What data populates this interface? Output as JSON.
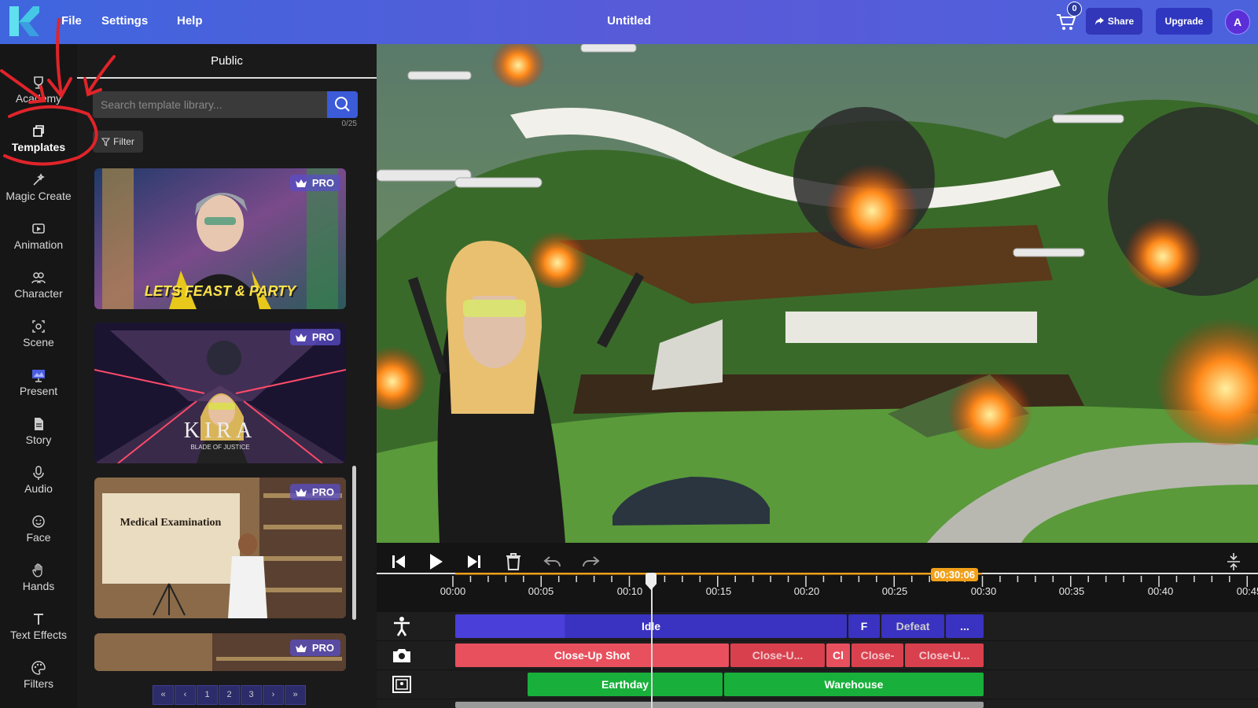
{
  "header": {
    "menu": [
      "File",
      "Settings",
      "Help"
    ],
    "title": "Untitled",
    "cart_count": "0",
    "share_label": "Share",
    "upgrade_label": "Upgrade",
    "avatar_initial": "A"
  },
  "sidebar": {
    "items": [
      {
        "label": "Academy",
        "icon": "trophy-icon"
      },
      {
        "label": "Templates",
        "icon": "templates-icon",
        "active": true
      },
      {
        "label": "Magic Create",
        "icon": "magic-wand-icon"
      },
      {
        "label": "Animation",
        "icon": "play-box-icon"
      },
      {
        "label": "Character",
        "icon": "people-icon"
      },
      {
        "label": "Scene",
        "icon": "scene-icon"
      },
      {
        "label": "Present",
        "icon": "present-icon"
      },
      {
        "label": "Story",
        "icon": "document-icon"
      },
      {
        "label": "Audio",
        "icon": "microphone-icon"
      },
      {
        "label": "Face",
        "icon": "face-icon"
      },
      {
        "label": "Hands",
        "icon": "hand-icon"
      },
      {
        "label": "Text Effects",
        "icon": "text-icon"
      },
      {
        "label": "Filters",
        "icon": "palette-icon"
      }
    ]
  },
  "panel": {
    "tab": "Public",
    "search_placeholder": "Search template library...",
    "counter": "0/25",
    "filter_label": "Filter",
    "cards": [
      {
        "badge": "PRO",
        "caption": "LETS FEAST & PARTY"
      },
      {
        "badge": "PRO",
        "caption": "KIRA",
        "subcaption": "BLADE OF JUSTICE"
      },
      {
        "badge": "PRO",
        "caption": "Medical Examination"
      },
      {
        "badge": "PRO"
      }
    ],
    "pages": [
      "«",
      "‹",
      "1",
      "2",
      "3",
      "›",
      "»"
    ]
  },
  "timeline": {
    "current_time": "00:30:06",
    "ticks": [
      "00:00",
      "00:05",
      "00:10",
      "00:15",
      "00:20",
      "00:25",
      "00:30",
      "00:35",
      "00:40",
      "00:45"
    ],
    "tracks": {
      "animation": [
        {
          "label": "Idle",
          "color": "#4a3fd8"
        },
        {
          "label": "F",
          "color": "#4a3fd8"
        },
        {
          "label": "Defeat",
          "color": "#4a3fd8"
        },
        {
          "label": "...",
          "color": "#4a3fd8"
        }
      ],
      "camera": [
        {
          "label": "Close-Up Shot",
          "color": "#e84a5a"
        },
        {
          "label": "Close-U...",
          "color": "#e84a5a"
        },
        {
          "label": "Cl",
          "color": "#e84a5a"
        },
        {
          "label": "Close-",
          "color": "#e84a5a"
        },
        {
          "label": "Close-U...",
          "color": "#e84a5a"
        }
      ],
      "scene": [
        {
          "label": "Earthday",
          "color": "#18b03a"
        },
        {
          "label": "Warehouse",
          "color": "#18b03a"
        }
      ]
    }
  },
  "colors": {
    "header": "#4b62dd",
    "accent": "#3b5bd9",
    "annotation": "#e0242a",
    "timeline_orange": "#f0a01a"
  }
}
